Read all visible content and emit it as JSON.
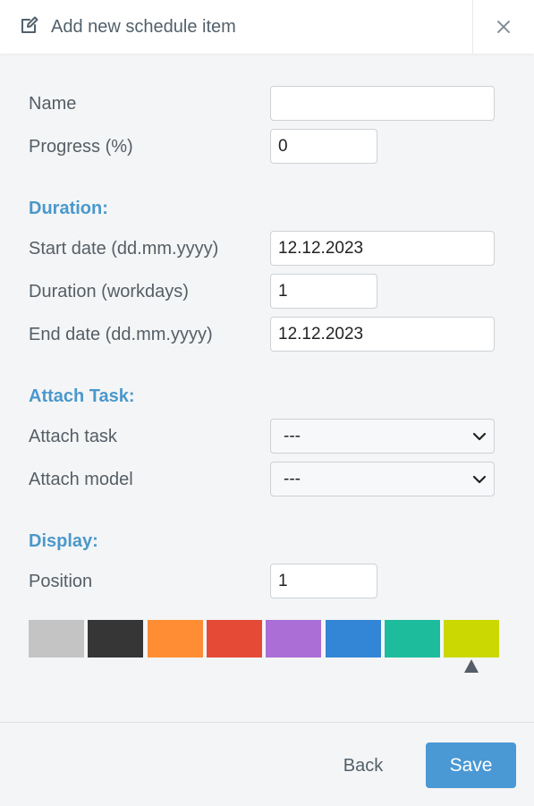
{
  "header": {
    "title": "Add new schedule item",
    "icon": "edit-icon",
    "close_icon": "close-icon"
  },
  "fields": {
    "name": {
      "label": "Name",
      "value": ""
    },
    "progress": {
      "label": "Progress (%)",
      "value": "0"
    }
  },
  "duration": {
    "title": "Duration:",
    "start_date": {
      "label": "Start date (dd.mm.yyyy)",
      "value": "12.12.2023"
    },
    "duration_workdays": {
      "label": "Duration (workdays)",
      "value": "1"
    },
    "end_date": {
      "label": "End date (dd.mm.yyyy)",
      "value": "12.12.2023"
    }
  },
  "attach": {
    "title": "Attach Task:",
    "task": {
      "label": "Attach task",
      "value": "---"
    },
    "model": {
      "label": "Attach model",
      "value": "---"
    }
  },
  "display": {
    "title": "Display:",
    "position": {
      "label": "Position",
      "value": "1"
    },
    "colors": [
      "#c4c4c4",
      "#363636",
      "#fe8d34",
      "#e54a37",
      "#aa6ed6",
      "#3386d6",
      "#1dbc9c",
      "#cbd802"
    ],
    "selected_color_index": 7
  },
  "footer": {
    "back_label": "Back",
    "save_label": "Save"
  },
  "theme": {
    "accent": "#4a98d4",
    "section_title_color": "#4a98cc"
  }
}
